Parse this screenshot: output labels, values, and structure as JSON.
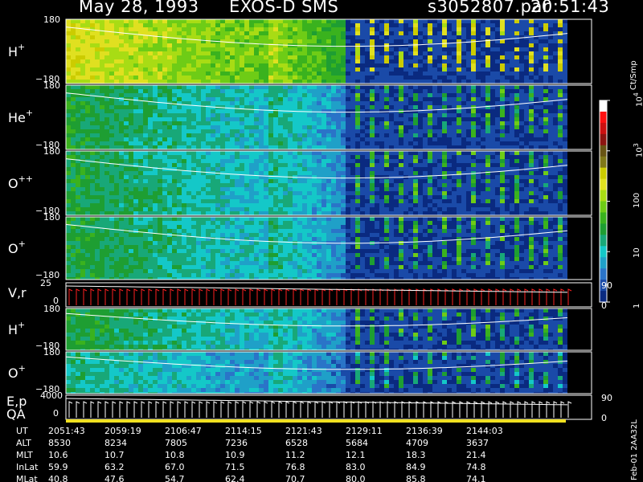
{
  "header": {
    "date": "May 28, 1993",
    "instrument": "EXOS-D SMS",
    "file": "s3052807.par",
    "time": "20:51:43"
  },
  "colorbar": {
    "unit": "Ct/Smp",
    "ticks": [
      {
        "label": "1",
        "value": 1
      },
      {
        "label": "10",
        "value": 10
      },
      {
        "label": "100",
        "value": 100
      },
      {
        "label": "10",
        "sup": "3",
        "value": 1000
      },
      {
        "label": "10",
        "sup": "4",
        "value": 10000
      }
    ],
    "colors": [
      "#0a2a80",
      "#1a4aa8",
      "#2a74c8",
      "#1fa0c8",
      "#14c8c8",
      "#18a878",
      "#1e9e32",
      "#3ab21e",
      "#6ecc16",
      "#a8dc14",
      "#e0e020",
      "#cccc00",
      "#807818",
      "#685414",
      "#8c1410",
      "#cc1010",
      "#ff1010",
      "#ffffff"
    ]
  },
  "chart_data": [
    {
      "type": "heatmap",
      "panel": "H+",
      "label": "H",
      "label_sup": "+",
      "ymax_label": "180",
      "ymin_label": "−180",
      "ylim": [
        -180,
        180
      ],
      "intensity": "high"
    },
    {
      "type": "heatmap",
      "panel": "He+",
      "label": "He",
      "label_sup": "+",
      "ymax_label": "180",
      "ymin_label": "−180",
      "ylim": [
        -180,
        180
      ],
      "intensity": "medium"
    },
    {
      "type": "heatmap",
      "panel": "O++",
      "label": "O",
      "label_sup": "++",
      "ymax_label": "180",
      "ymin_label": "−180",
      "ylim": [
        -180,
        180
      ],
      "intensity": "medium"
    },
    {
      "type": "heatmap",
      "panel": "O+",
      "label": "O",
      "label_sup": "+",
      "ymax_label": "180",
      "ymin_label": "−180",
      "ylim": [
        -180,
        180
      ],
      "intensity": "medium"
    },
    {
      "type": "line",
      "panel": "V,r",
      "label": "V,r",
      "ymax_label": "25",
      "ymin_label": "0",
      "right_top": "90",
      "right_bottom": "0"
    },
    {
      "type": "heatmap",
      "panel": "H+ (2)",
      "label": "H",
      "label_sup": "+",
      "ymax_label": "180",
      "ymin_label": "−180",
      "ylim": [
        -180,
        180
      ],
      "intensity": "medium"
    },
    {
      "type": "heatmap",
      "panel": "O+ (2)",
      "label": "O",
      "label_sup": "+",
      "ymax_label": "180",
      "ymin_label": "−180",
      "ylim": [
        -180,
        180
      ],
      "intensity": "low"
    },
    {
      "type": "line",
      "panel": "E,p QA",
      "label": "E,p",
      "label2": "QA",
      "ymax_label": "4000",
      "ymin_label": "0",
      "right_top": "90",
      "right_bottom": "0"
    }
  ],
  "orbit_table": {
    "rows": [
      {
        "name": "UT",
        "values": [
          "2051:43",
          "2059:19",
          "2106:47",
          "2114:15",
          "2121:43",
          "2129:11",
          "2136:39",
          "2144:03"
        ]
      },
      {
        "name": "ALT",
        "values": [
          "8530",
          "8234",
          "7805",
          "7236",
          "6528",
          "5684",
          "4709",
          "3637"
        ]
      },
      {
        "name": "MLT",
        "values": [
          "10.6",
          "10.7",
          "10.8",
          "10.9",
          "11.2",
          "12.1",
          "18.3",
          "21.4"
        ]
      },
      {
        "name": "InLat",
        "values": [
          "59.9",
          "63.2",
          "67.0",
          "71.5",
          "76.8",
          "83.0",
          "84.9",
          "74.8"
        ]
      },
      {
        "name": "MLat",
        "values": [
          "40.8",
          "47.6",
          "54.7",
          "62.4",
          "70.7",
          "80.0",
          "85.8",
          "74.1"
        ]
      }
    ]
  },
  "stamp": "Feb-01 2AA32L"
}
